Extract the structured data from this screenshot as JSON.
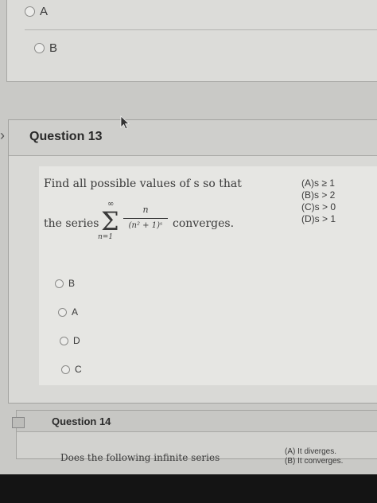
{
  "previous_question": {
    "options": [
      {
        "label": "A"
      },
      {
        "label": "B"
      }
    ]
  },
  "question13": {
    "title": "Question 13",
    "prompt_line1": "Find all possible values of s so that",
    "series_lead": "the series",
    "sum_upper": "∞",
    "sum_lower": "n=1",
    "frac_numerator": "n",
    "frac_denominator": "(n² + 1)ˢ",
    "series_tail": "converges.",
    "choices": [
      "(A)s ≥ 1",
      "(B)s > 2",
      "(C)s > 0",
      "(D)s > 1"
    ],
    "answers": [
      {
        "label": "B"
      },
      {
        "label": "A"
      },
      {
        "label": "D"
      },
      {
        "label": "C"
      }
    ]
  },
  "question14": {
    "title": "Question 14",
    "prompt": "Does the following infinite series",
    "choices": [
      "(A) It diverges.",
      "(B) It converges."
    ]
  }
}
